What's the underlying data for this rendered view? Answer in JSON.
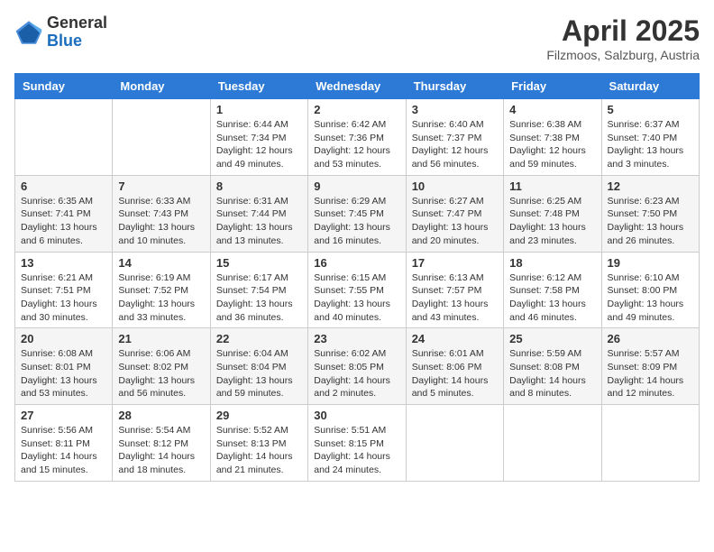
{
  "header": {
    "logo_line1": "General",
    "logo_line2": "Blue",
    "title": "April 2025",
    "subtitle": "Filzmoos, Salzburg, Austria"
  },
  "days_of_week": [
    "Sunday",
    "Monday",
    "Tuesday",
    "Wednesday",
    "Thursday",
    "Friday",
    "Saturday"
  ],
  "weeks": [
    [
      {
        "day": "",
        "content": ""
      },
      {
        "day": "",
        "content": ""
      },
      {
        "day": "1",
        "content": "Sunrise: 6:44 AM\nSunset: 7:34 PM\nDaylight: 12 hours and 49 minutes."
      },
      {
        "day": "2",
        "content": "Sunrise: 6:42 AM\nSunset: 7:36 PM\nDaylight: 12 hours and 53 minutes."
      },
      {
        "day": "3",
        "content": "Sunrise: 6:40 AM\nSunset: 7:37 PM\nDaylight: 12 hours and 56 minutes."
      },
      {
        "day": "4",
        "content": "Sunrise: 6:38 AM\nSunset: 7:38 PM\nDaylight: 12 hours and 59 minutes."
      },
      {
        "day": "5",
        "content": "Sunrise: 6:37 AM\nSunset: 7:40 PM\nDaylight: 13 hours and 3 minutes."
      }
    ],
    [
      {
        "day": "6",
        "content": "Sunrise: 6:35 AM\nSunset: 7:41 PM\nDaylight: 13 hours and 6 minutes."
      },
      {
        "day": "7",
        "content": "Sunrise: 6:33 AM\nSunset: 7:43 PM\nDaylight: 13 hours and 10 minutes."
      },
      {
        "day": "8",
        "content": "Sunrise: 6:31 AM\nSunset: 7:44 PM\nDaylight: 13 hours and 13 minutes."
      },
      {
        "day": "9",
        "content": "Sunrise: 6:29 AM\nSunset: 7:45 PM\nDaylight: 13 hours and 16 minutes."
      },
      {
        "day": "10",
        "content": "Sunrise: 6:27 AM\nSunset: 7:47 PM\nDaylight: 13 hours and 20 minutes."
      },
      {
        "day": "11",
        "content": "Sunrise: 6:25 AM\nSunset: 7:48 PM\nDaylight: 13 hours and 23 minutes."
      },
      {
        "day": "12",
        "content": "Sunrise: 6:23 AM\nSunset: 7:50 PM\nDaylight: 13 hours and 26 minutes."
      }
    ],
    [
      {
        "day": "13",
        "content": "Sunrise: 6:21 AM\nSunset: 7:51 PM\nDaylight: 13 hours and 30 minutes."
      },
      {
        "day": "14",
        "content": "Sunrise: 6:19 AM\nSunset: 7:52 PM\nDaylight: 13 hours and 33 minutes."
      },
      {
        "day": "15",
        "content": "Sunrise: 6:17 AM\nSunset: 7:54 PM\nDaylight: 13 hours and 36 minutes."
      },
      {
        "day": "16",
        "content": "Sunrise: 6:15 AM\nSunset: 7:55 PM\nDaylight: 13 hours and 40 minutes."
      },
      {
        "day": "17",
        "content": "Sunrise: 6:13 AM\nSunset: 7:57 PM\nDaylight: 13 hours and 43 minutes."
      },
      {
        "day": "18",
        "content": "Sunrise: 6:12 AM\nSunset: 7:58 PM\nDaylight: 13 hours and 46 minutes."
      },
      {
        "day": "19",
        "content": "Sunrise: 6:10 AM\nSunset: 8:00 PM\nDaylight: 13 hours and 49 minutes."
      }
    ],
    [
      {
        "day": "20",
        "content": "Sunrise: 6:08 AM\nSunset: 8:01 PM\nDaylight: 13 hours and 53 minutes."
      },
      {
        "day": "21",
        "content": "Sunrise: 6:06 AM\nSunset: 8:02 PM\nDaylight: 13 hours and 56 minutes."
      },
      {
        "day": "22",
        "content": "Sunrise: 6:04 AM\nSunset: 8:04 PM\nDaylight: 13 hours and 59 minutes."
      },
      {
        "day": "23",
        "content": "Sunrise: 6:02 AM\nSunset: 8:05 PM\nDaylight: 14 hours and 2 minutes."
      },
      {
        "day": "24",
        "content": "Sunrise: 6:01 AM\nSunset: 8:06 PM\nDaylight: 14 hours and 5 minutes."
      },
      {
        "day": "25",
        "content": "Sunrise: 5:59 AM\nSunset: 8:08 PM\nDaylight: 14 hours and 8 minutes."
      },
      {
        "day": "26",
        "content": "Sunrise: 5:57 AM\nSunset: 8:09 PM\nDaylight: 14 hours and 12 minutes."
      }
    ],
    [
      {
        "day": "27",
        "content": "Sunrise: 5:56 AM\nSunset: 8:11 PM\nDaylight: 14 hours and 15 minutes."
      },
      {
        "day": "28",
        "content": "Sunrise: 5:54 AM\nSunset: 8:12 PM\nDaylight: 14 hours and 18 minutes."
      },
      {
        "day": "29",
        "content": "Sunrise: 5:52 AM\nSunset: 8:13 PM\nDaylight: 14 hours and 21 minutes."
      },
      {
        "day": "30",
        "content": "Sunrise: 5:51 AM\nSunset: 8:15 PM\nDaylight: 14 hours and 24 minutes."
      },
      {
        "day": "",
        "content": ""
      },
      {
        "day": "",
        "content": ""
      },
      {
        "day": "",
        "content": ""
      }
    ]
  ]
}
